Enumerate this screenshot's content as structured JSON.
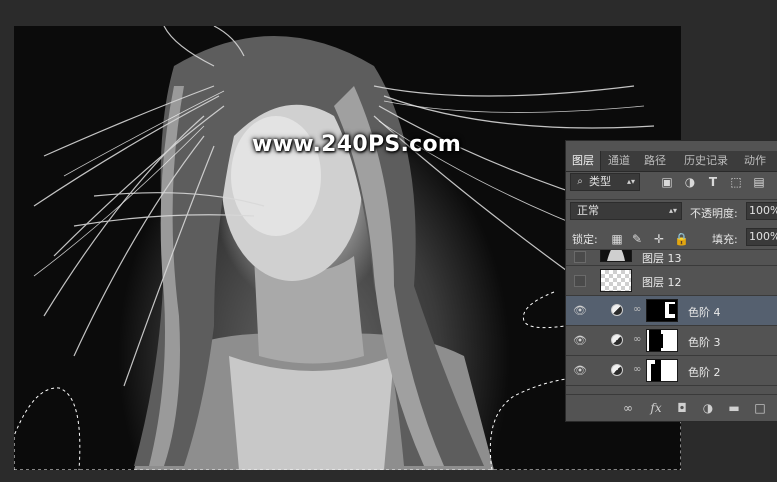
{
  "canvas": {
    "watermark": "www.240PS.com"
  },
  "layers_panel": {
    "tabs": [
      {
        "label": "图层",
        "active": true
      },
      {
        "label": "通道",
        "active": false
      },
      {
        "label": "路径",
        "active": false
      },
      {
        "label": "历史记录",
        "active": false
      },
      {
        "label": "动作",
        "active": false
      }
    ],
    "filter": {
      "search_icon": "search-icon",
      "kind_label": "类型",
      "filter_icons": [
        "image-filter-icon",
        "adjustment-filter-icon",
        "type-filter-icon",
        "shape-filter-icon",
        "smart-object-filter-icon"
      ]
    },
    "blend_mode": "正常",
    "opacity_label": "不透明度:",
    "opacity_value": "100%",
    "lock_label": "锁定:",
    "lock_icons": [
      "lock-transparent-icon",
      "lock-paint-icon",
      "lock-move-icon",
      "lock-all-icon"
    ],
    "fill_label": "填充:",
    "fill_value": "100%",
    "layers": [
      {
        "name": "图层 13",
        "type": "pixel",
        "visible": false,
        "selected": false
      },
      {
        "name": "图层 12",
        "type": "pixel",
        "visible": false,
        "selected": false
      },
      {
        "name": "色阶 4",
        "type": "levels",
        "visible": true,
        "selected": true
      },
      {
        "name": "色阶 3",
        "type": "levels",
        "visible": true,
        "selected": false
      },
      {
        "name": "色阶 2",
        "type": "levels",
        "visible": true,
        "selected": false
      }
    ],
    "footer_icons": [
      "link-icon",
      "fx-icon",
      "add-mask-icon",
      "new-adjustment-icon",
      "new-group-icon",
      "new-layer-icon"
    ],
    "fx_label": "fx",
    "colors": {
      "panel_bg": "#535353",
      "selected_row": "#55606f",
      "tab_bar": "#3c3c3c"
    }
  }
}
